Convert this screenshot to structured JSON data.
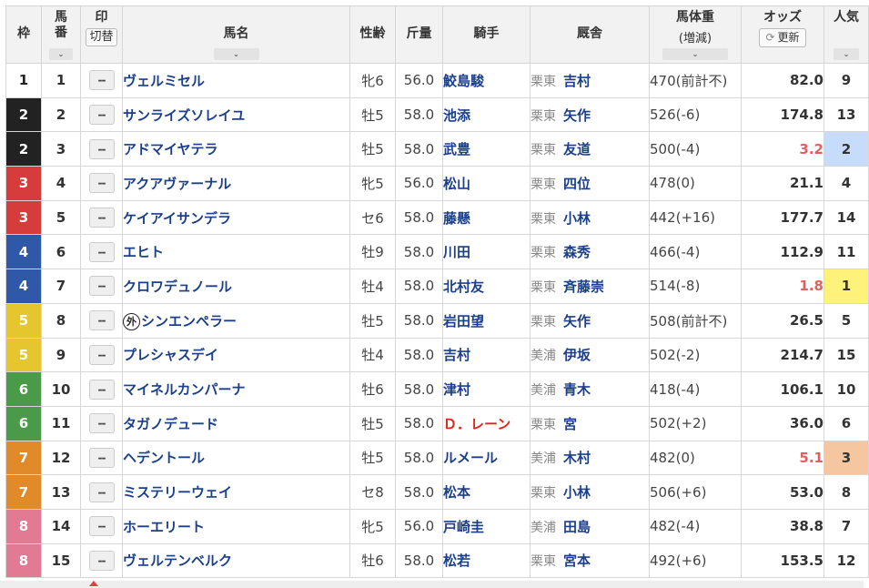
{
  "headers": {
    "waku": "枠",
    "umaban_l1": "馬",
    "umaban_l2": "番",
    "mark": "印",
    "mark_toggle": "切替",
    "horse": "馬名",
    "sexage": "性齢",
    "weight": "斤量",
    "jockey": "騎手",
    "trainer": "厩舎",
    "bodyweight": "馬体重",
    "bodyweight_sub": "(増減)",
    "odds": "オッズ",
    "odds_update": "更新",
    "pop": "人気",
    "sort_arrow": "⌄"
  },
  "mark_empty": "--",
  "foreign_mark": "外",
  "colors": {
    "waku1": "#ffffff",
    "waku2": "#222222",
    "waku3": "#d73c3c",
    "waku4": "#2f58a8",
    "waku5": "#e6c62e",
    "waku6": "#4a9a4a",
    "waku7": "#e08a2a",
    "waku8": "#e27a93",
    "pop1": "#fff27a",
    "pop2": "#c7dcfa",
    "pop3": "#f4c7a0",
    "name_blue": "#1b3f8b",
    "odds_red": "#e06060"
  },
  "rows": [
    {
      "waku": "1",
      "umaban": "1",
      "horse": "ヴェルミセル",
      "foreign": false,
      "sexage": "牝6",
      "weight": "56.0",
      "jockey": "鮫島駿",
      "area": "栗東",
      "trainer": "吉村",
      "bodyweight": "470(前計不)",
      "odds": "82.0",
      "pop": "9"
    },
    {
      "waku": "2",
      "umaban": "2",
      "horse": "サンライズソレイユ",
      "foreign": false,
      "sexage": "牡5",
      "weight": "58.0",
      "jockey": "池添",
      "area": "栗東",
      "trainer": "矢作",
      "bodyweight": "526(-6)",
      "odds": "174.8",
      "pop": "13"
    },
    {
      "waku": "2",
      "umaban": "3",
      "horse": "アドマイヤテラ",
      "foreign": false,
      "sexage": "牡5",
      "weight": "58.0",
      "jockey": "武豊",
      "area": "栗東",
      "trainer": "友道",
      "bodyweight": "500(-4)",
      "odds": "3.2",
      "pop": "2"
    },
    {
      "waku": "3",
      "umaban": "4",
      "horse": "アクアヴァーナル",
      "foreign": false,
      "sexage": "牝5",
      "weight": "56.0",
      "jockey": "松山",
      "area": "栗東",
      "trainer": "四位",
      "bodyweight": "478(0)",
      "odds": "21.1",
      "pop": "4"
    },
    {
      "waku": "3",
      "umaban": "5",
      "horse": "ケイアイサンデラ",
      "foreign": false,
      "sexage": "セ6",
      "weight": "58.0",
      "jockey": "藤懸",
      "area": "栗東",
      "trainer": "小林",
      "bodyweight": "442(+16)",
      "odds": "177.7",
      "pop": "14"
    },
    {
      "waku": "4",
      "umaban": "6",
      "horse": "エヒト",
      "foreign": false,
      "sexage": "牡9",
      "weight": "58.0",
      "jockey": "川田",
      "area": "栗東",
      "trainer": "森秀",
      "bodyweight": "466(-4)",
      "odds": "112.9",
      "pop": "11"
    },
    {
      "waku": "4",
      "umaban": "7",
      "horse": "クロワデュノール",
      "foreign": false,
      "sexage": "牡4",
      "weight": "58.0",
      "jockey": "北村友",
      "area": "栗東",
      "trainer": "斉藤崇",
      "bodyweight": "514(-8)",
      "odds": "1.8",
      "pop": "1"
    },
    {
      "waku": "5",
      "umaban": "8",
      "horse": "シンエンペラー",
      "foreign": true,
      "sexage": "牡5",
      "weight": "58.0",
      "jockey": "岩田望",
      "area": "栗東",
      "trainer": "矢作",
      "bodyweight": "508(前計不)",
      "odds": "26.5",
      "pop": "5"
    },
    {
      "waku": "5",
      "umaban": "9",
      "horse": "プレシャスデイ",
      "foreign": false,
      "sexage": "牡4",
      "weight": "58.0",
      "jockey": "吉村",
      "area": "美浦",
      "trainer": "伊坂",
      "bodyweight": "502(-2)",
      "odds": "214.7",
      "pop": "15"
    },
    {
      "waku": "6",
      "umaban": "10",
      "horse": "マイネルカンパーナ",
      "foreign": false,
      "sexage": "牡6",
      "weight": "58.0",
      "jockey": "津村",
      "area": "美浦",
      "trainer": "青木",
      "bodyweight": "418(-4)",
      "odds": "106.1",
      "pop": "10"
    },
    {
      "waku": "6",
      "umaban": "11",
      "horse": "タガノデュード",
      "foreign": false,
      "sexage": "牡5",
      "weight": "58.0",
      "jockey": "Ｄ．レーン",
      "area": "栗東",
      "trainer": "宮",
      "bodyweight": "502(+2)",
      "odds": "36.0",
      "pop": "6"
    },
    {
      "waku": "7",
      "umaban": "12",
      "horse": "ヘデントール",
      "foreign": false,
      "sexage": "牡5",
      "weight": "58.0",
      "jockey": "ルメール",
      "area": "美浦",
      "trainer": "木村",
      "bodyweight": "482(0)",
      "odds": "5.1",
      "pop": "3"
    },
    {
      "waku": "7",
      "umaban": "13",
      "horse": "ミステリーウェイ",
      "foreign": false,
      "sexage": "セ8",
      "weight": "58.0",
      "jockey": "松本",
      "area": "栗東",
      "trainer": "小林",
      "bodyweight": "506(+6)",
      "odds": "53.0",
      "pop": "8"
    },
    {
      "waku": "8",
      "umaban": "14",
      "horse": "ホーエリート",
      "foreign": false,
      "sexage": "牝5",
      "weight": "56.0",
      "jockey": "戸崎圭",
      "area": "美浦",
      "trainer": "田島",
      "bodyweight": "482(-4)",
      "odds": "38.8",
      "pop": "7"
    },
    {
      "waku": "8",
      "umaban": "15",
      "horse": "ヴェルテンベルク",
      "foreign": false,
      "sexage": "牡6",
      "weight": "58.0",
      "jockey": "松若",
      "area": "栗東",
      "trainer": "宮本",
      "bodyweight": "492(+6)",
      "odds": "153.5",
      "pop": "12"
    }
  ]
}
